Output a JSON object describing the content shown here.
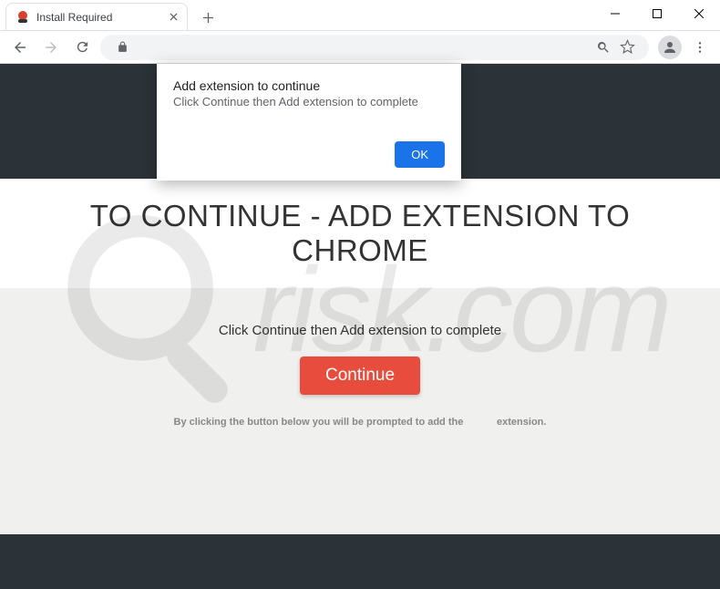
{
  "window": {
    "tab_title": "Install Required"
  },
  "dialog": {
    "title": "Add extension to continue",
    "message": "Click Continue then Add extension to complete",
    "ok_label": "OK"
  },
  "page": {
    "heading": "TO CONTINUE - ADD EXTENSION TO CHROME",
    "instruction": "Click Continue then Add extension to complete",
    "continue_label": "Continue",
    "subtext_before": "By clicking the button below you will be prompted to add the",
    "subtext_after": "extension."
  }
}
